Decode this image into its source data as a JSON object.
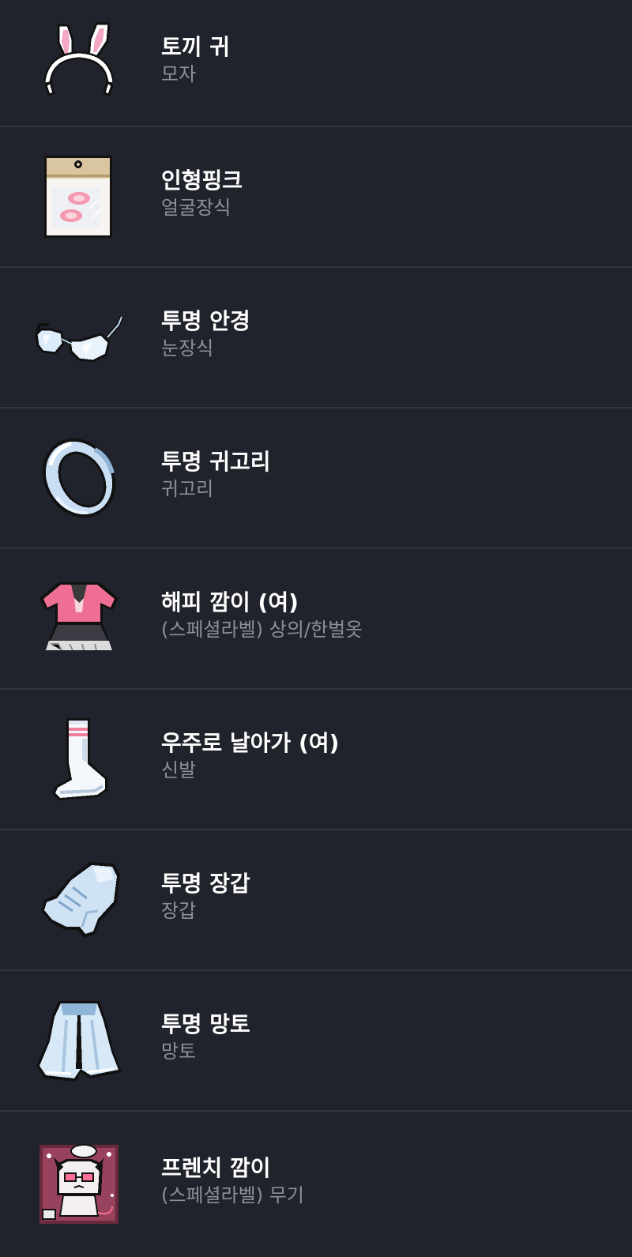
{
  "items": [
    {
      "name": "토끼 귀",
      "category": "모자",
      "icon": "bunny-ears-headband-icon"
    },
    {
      "name": "인형핑크",
      "category": "얼굴장식",
      "icon": "pink-blush-sticker-icon"
    },
    {
      "name": "투명 안경",
      "category": "눈장식",
      "icon": "transparent-glasses-icon"
    },
    {
      "name": "투명 귀고리",
      "category": "귀고리",
      "icon": "transparent-earring-icon"
    },
    {
      "name": "해피 깜이 (여)",
      "category": "(스페셜라벨) 상의/한벌옷",
      "icon": "pink-dress-outfit-icon"
    },
    {
      "name": "우주로 날아가 (여)",
      "category": "신발",
      "icon": "white-sock-icon"
    },
    {
      "name": "투명 장갑",
      "category": "장갑",
      "icon": "transparent-glove-icon"
    },
    {
      "name": "투명 망토",
      "category": "망토",
      "icon": "transparent-cape-icon"
    },
    {
      "name": "프렌치 깜이",
      "category": "(스페셜라벨) 무기",
      "icon": "french-cat-weapon-icon"
    }
  ],
  "colors": {
    "background": "#20232b",
    "divider": "#31353f",
    "title": "#ffffff",
    "subtitle": "#8c909a"
  }
}
